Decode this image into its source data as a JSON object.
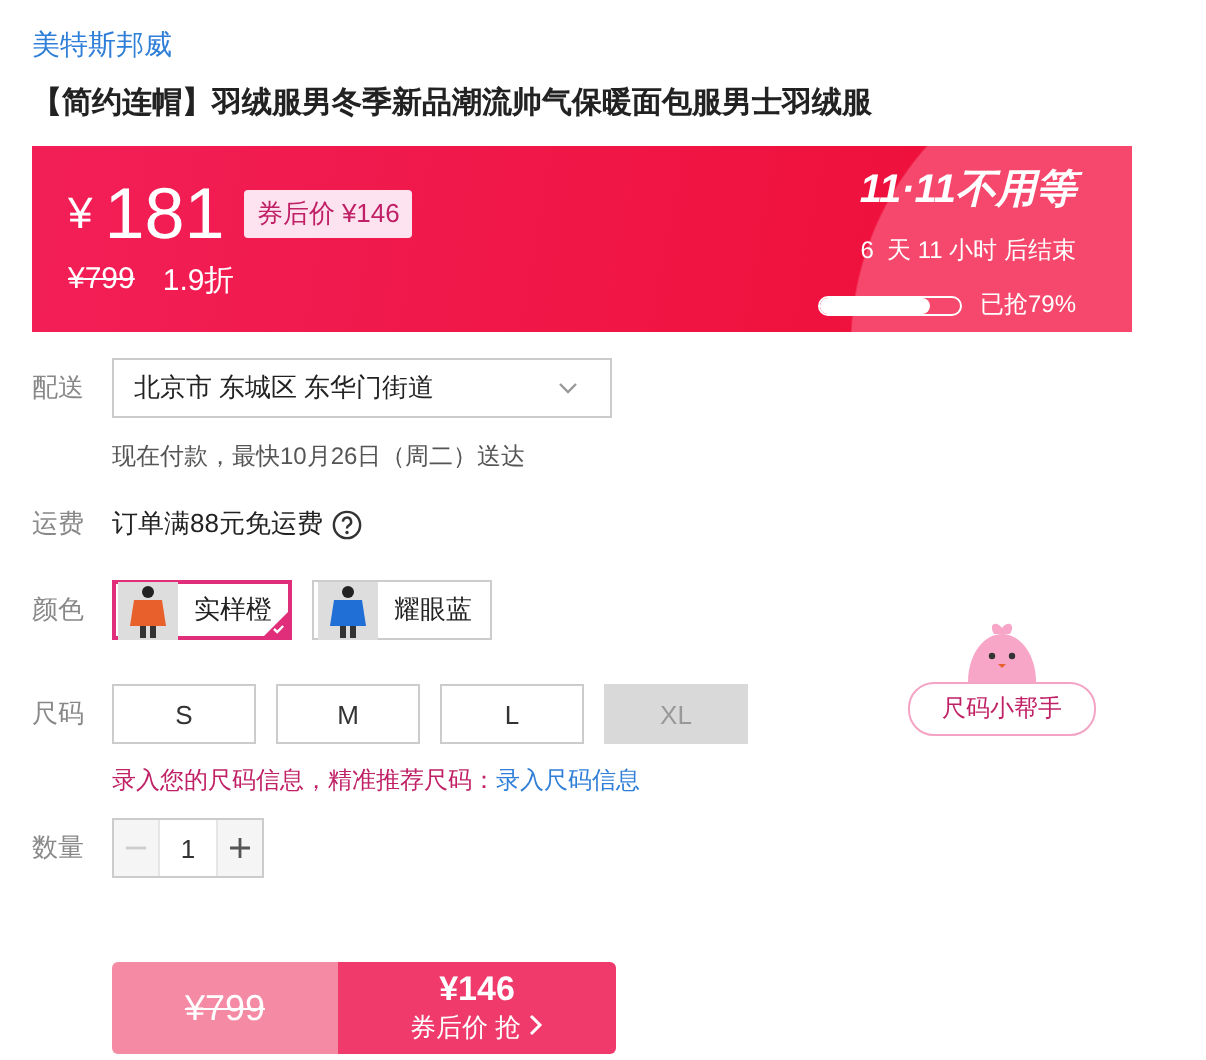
{
  "brand": "美特斯邦威",
  "title": "【简约连帽】羽绒服男冬季新品潮流帅气保暖面包服男士羽绒服",
  "price": {
    "currency": "¥",
    "amount": "181",
    "coupon": "券后价 ¥146",
    "original": "¥799",
    "discount": "1.9折"
  },
  "promo": {
    "headline": "11·11不用等",
    "countdown": "6  天 11 小时 后结束",
    "level": 0.79,
    "sold": "已抢79%"
  },
  "delivery": {
    "label": "配送",
    "address": "北京市 东城区 东华门街道",
    "eta": "现在付款，最快10月26日（周二）送达"
  },
  "shipping": {
    "label": "运费",
    "text": "订单满88元免运费"
  },
  "colors": {
    "label": "颜色",
    "items": [
      {
        "name": "实样橙",
        "selected": true,
        "color": "#e8612c"
      },
      {
        "name": "耀眼蓝",
        "selected": false,
        "color": "#1f6fd6"
      }
    ]
  },
  "sizes": {
    "label": "尺码",
    "items": [
      {
        "name": "S",
        "disabled": false
      },
      {
        "name": "M",
        "disabled": false
      },
      {
        "name": "L",
        "disabled": false
      },
      {
        "name": "XL",
        "disabled": true
      }
    ],
    "helper": "尺码小帮手",
    "hint": "录入您的尺码信息，精准推荐尺码：",
    "link": "录入尺码信息"
  },
  "quantity": {
    "label": "数量",
    "value": "1",
    "decrease_disabled": true
  },
  "buy": {
    "original": "¥799",
    "price": "¥146",
    "action": "券后价 抢"
  }
}
